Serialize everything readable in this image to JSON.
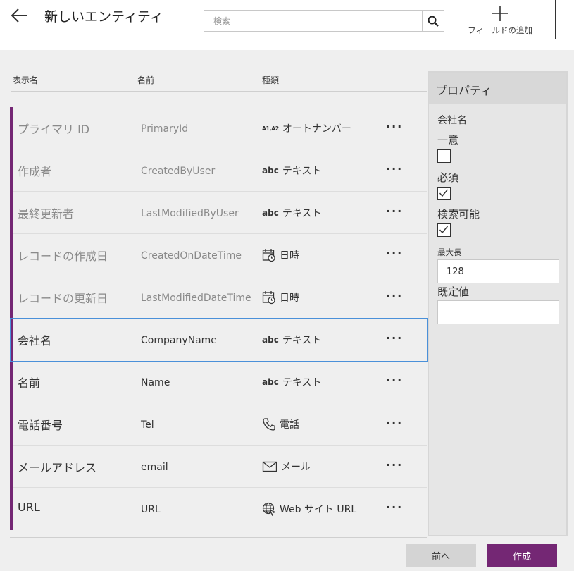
{
  "header": {
    "title": "新しいエンティティ",
    "search_placeholder": "検索",
    "add_field_label": "フィールドの追加"
  },
  "columns": {
    "display_name": "表示名",
    "name": "名前",
    "type": "種類"
  },
  "rows": [
    {
      "display": "プライマリ ID",
      "name": "PrimaryId",
      "type_icon": "A1,A2",
      "type": "オートナンバー",
      "more": "···"
    },
    {
      "display": "作成者",
      "name": "CreatedByUser",
      "type_icon": "abc",
      "type": "テキスト",
      "more": "···"
    },
    {
      "display": "最終更新者",
      "name": "LastModifiedByUser",
      "type_icon": "abc",
      "type": "テキスト",
      "more": "···"
    },
    {
      "display": "レコードの作成日",
      "name": "CreatedOnDateTime",
      "type_icon": "calendar-clock-icon",
      "type": "日時",
      "more": "···"
    },
    {
      "display": "レコードの更新日",
      "name": "LastModifiedDateTime",
      "type_icon": "calendar-clock-icon",
      "type": "日時",
      "more": "···"
    },
    {
      "display": "会社名",
      "name": "CompanyName",
      "type_icon": "abc",
      "type": "テキスト",
      "more": "···"
    },
    {
      "display": "名前",
      "name": "Name",
      "type_icon": "abc",
      "type": "テキスト",
      "more": "···"
    },
    {
      "display": "電話番号",
      "name": "Tel",
      "type_icon": "phone-icon",
      "type": "電話",
      "more": "···"
    },
    {
      "display": "メールアドレス",
      "name": "email",
      "type_icon": "mail-icon",
      "type": "メール",
      "more": "···"
    },
    {
      "display": "URL",
      "name": "URL",
      "type_icon": "globe-icon",
      "type": "Web サイト URL",
      "more": "···"
    }
  ],
  "properties": {
    "title": "プロパティ",
    "entity": "会社名",
    "unique_label": "一意",
    "unique_checked": false,
    "required_label": "必須",
    "required_checked": true,
    "searchable_label": "検索可能",
    "searchable_checked": true,
    "max_length_label": "最大長",
    "max_length_value": "128",
    "default_label": "既定値",
    "default_value": ""
  },
  "footer": {
    "prev_label": "前へ",
    "create_label": "作成"
  },
  "colors": {
    "accent": "#742774",
    "selection": "#4a90d9"
  }
}
